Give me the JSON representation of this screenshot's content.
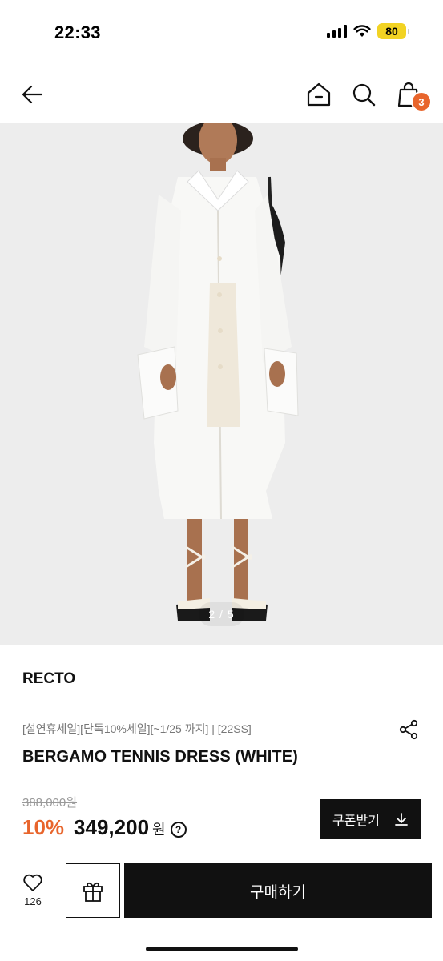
{
  "status_bar": {
    "time": "22:33",
    "battery": "80"
  },
  "nav": {
    "cart_count": "3"
  },
  "gallery": {
    "counter": "2 / 5"
  },
  "product": {
    "brand": "RECTO",
    "promo": "[설연휴세일][단독10%세일][~1/25 까지] | [22SS]",
    "name": "BERGAMO TENNIS DRESS (WHITE)",
    "original_price": "388,000원",
    "discount": "10%",
    "sale_price": "349,200",
    "currency": "원",
    "help_symbol": "?"
  },
  "coupon": {
    "label": "쿠폰받기"
  },
  "bottom_bar": {
    "like_count": "126",
    "buy_label": "구매하기"
  },
  "colors": {
    "accent": "#e8652c",
    "battery": "#f2d323",
    "dark": "#111111"
  },
  "icons": [
    "signal-icon",
    "wifi-icon",
    "back-arrow-icon",
    "home-icon",
    "search-icon",
    "shopping-bag-icon",
    "share-icon",
    "download-icon",
    "heart-icon",
    "gift-icon",
    "help-icon"
  ]
}
